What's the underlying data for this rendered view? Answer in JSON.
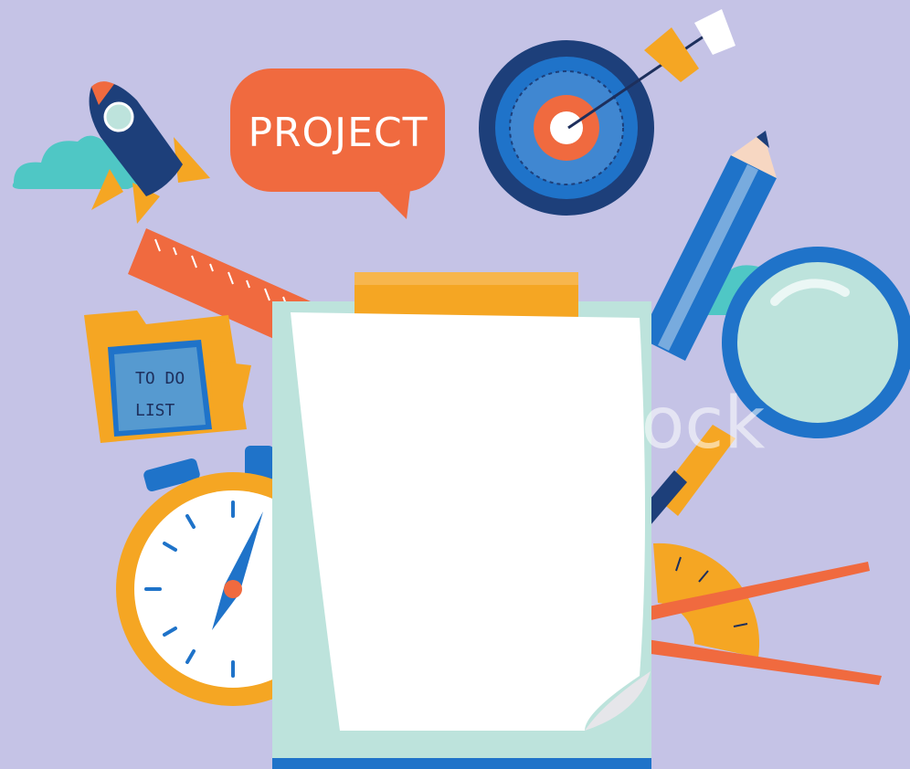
{
  "speech_bubble": {
    "text": "PROJECT"
  },
  "folder": {
    "line1": "TO DO",
    "line2": "LIST"
  },
  "watermark": {
    "text": "Adobe Stock"
  },
  "colors": {
    "background": "#c5c3e6",
    "orange": "#f06a3f",
    "yellow": "#f5a623",
    "navy": "#1d3f7a",
    "blue": "#1f73c9",
    "mint": "#bde3dc",
    "cloud": "#4fc7c5"
  }
}
